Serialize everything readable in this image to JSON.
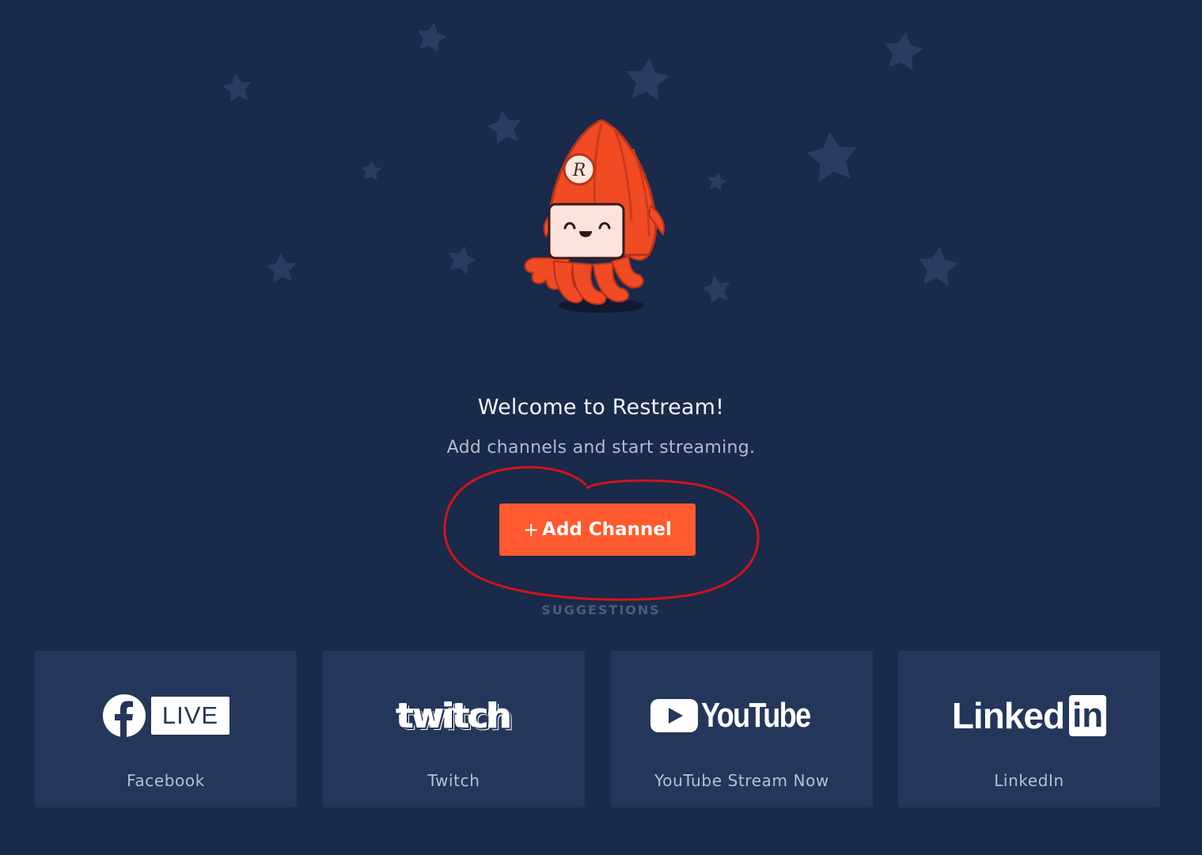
{
  "welcome": {
    "title": "Welcome to Restream!",
    "subtitle": "Add channels and start streaming."
  },
  "add_channel": {
    "plus": "+",
    "label": "Add Channel"
  },
  "suggestions": {
    "heading": "SUGGESTIONS",
    "items": [
      {
        "label": "Facebook",
        "logo_text": "LIVE",
        "icon": "facebook-live-logo"
      },
      {
        "label": "Twitch",
        "logo_text": "twitch",
        "icon": "twitch-logo"
      },
      {
        "label": "YouTube Stream Now",
        "logo_text": "YouTube",
        "icon": "youtube-logo"
      },
      {
        "label": "LinkedIn",
        "logo_text": "Linked",
        "logo_box": "in",
        "icon": "linkedin-logo"
      }
    ]
  },
  "colors": {
    "background": "#192a4b",
    "card": "#24375a",
    "accent": "#ff5a2f",
    "annotation": "#d1141c"
  }
}
